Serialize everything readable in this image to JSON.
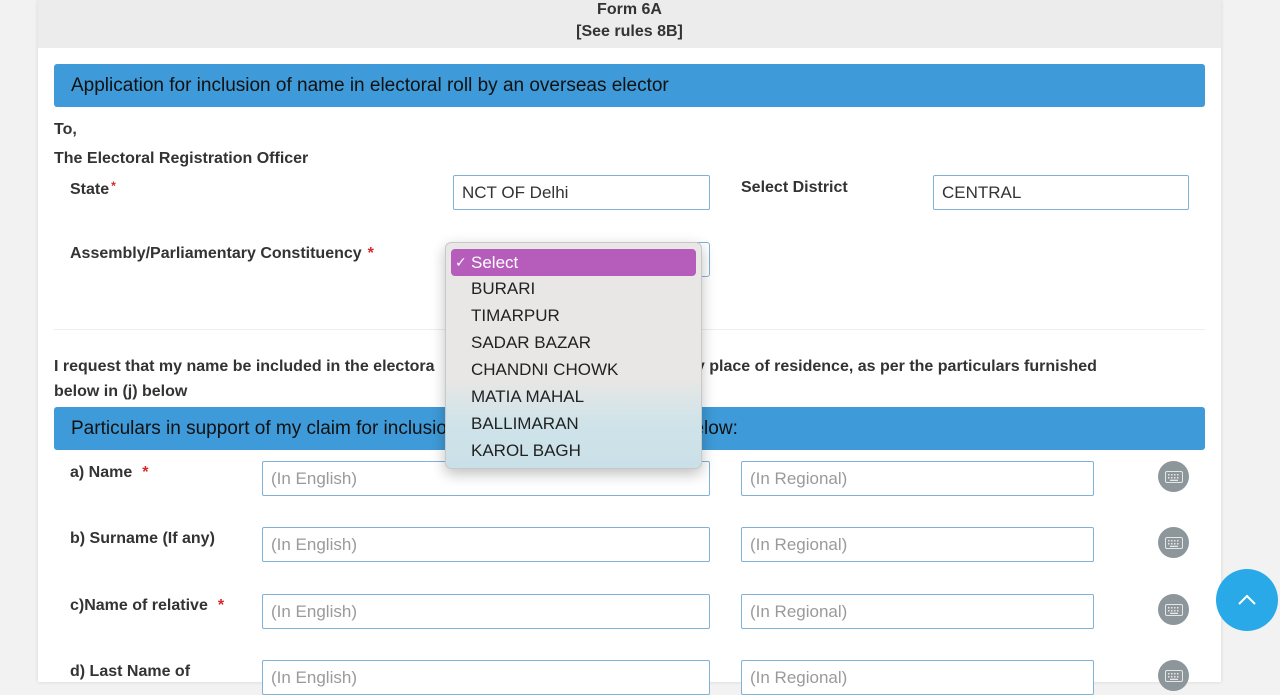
{
  "form": {
    "title": "Form 6A",
    "subtitle": "[See rules 8B]"
  },
  "header_bar": "Application for inclusion of name in electoral roll by an overseas elector",
  "to": "To,",
  "officer": "The Electoral Registration Officer",
  "state": {
    "label": "State",
    "required": "*",
    "value": "NCT OF Delhi"
  },
  "district": {
    "label": "Select District",
    "value": "CENTRAL"
  },
  "constituency": {
    "label": "Assembly/Parliamentary Constituency",
    "required": "*",
    "selected": "Select",
    "options": [
      "Select",
      "BURARI",
      "TIMARPUR",
      "SADAR BAZAR",
      "CHANDNI CHOWK",
      "MATIA MAHAL",
      "BALLIMARAN",
      "KAROL BAGH"
    ]
  },
  "request": {
    "line1_left": "I request that my name be included in the electora",
    "line1_right": "ch my place of residence, as per the particulars furnished",
    "line2": "below in (j) below"
  },
  "particulars_bar": {
    "left": "Particulars in support of my claim for inclusio",
    "right": "below:"
  },
  "fields": [
    {
      "label": "a) Name",
      "required": "*",
      "english_placeholder": "(In English)",
      "regional_placeholder": "(In Regional)"
    },
    {
      "label": "b) Surname (If any)",
      "required": "",
      "english_placeholder": "(In English)",
      "regional_placeholder": "(In Regional)"
    },
    {
      "label": "c)Name of relative",
      "required": "*",
      "english_placeholder": "(In English)",
      "regional_placeholder": "(In Regional)"
    },
    {
      "label": "d) Last Name of",
      "required": "",
      "english_placeholder": "(In English)",
      "regional_placeholder": "(In Regional)"
    }
  ],
  "icons": {
    "keyboard": "keyboard-icon",
    "scroll_top": "chevron-up-icon",
    "checkmark": "✓"
  },
  "colors": {
    "accent_bar": "#3e9ad8",
    "required": "#d9262a",
    "selected_option": "#b65cbb",
    "fab": "#2aa9e8"
  }
}
